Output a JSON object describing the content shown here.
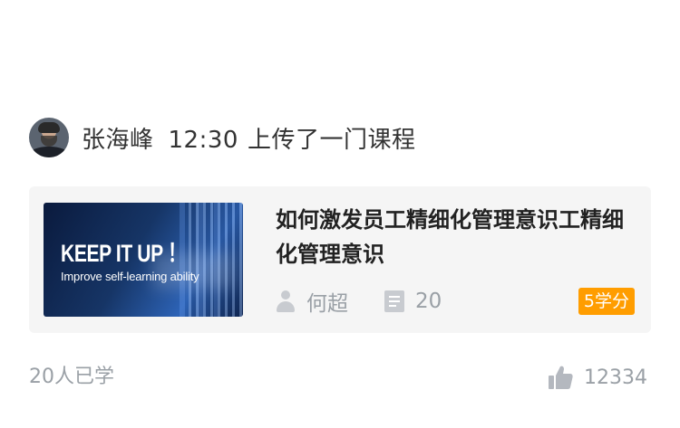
{
  "post": {
    "author": "张海峰",
    "time": "12:30",
    "action": "上传了一门课程"
  },
  "course": {
    "thumbnail_title": "KEEP IT UP ！",
    "thumbnail_subtitle": "Improve self-learning ability",
    "title": "如何激发员工精细化管理意识工精细化管理意识",
    "instructor": "何超",
    "lesson_count": "20",
    "credits": "5学分"
  },
  "footer": {
    "learners": "20人已学",
    "likes": "12334"
  },
  "icons": {
    "instructor": "person-icon",
    "lessons": "document-icon",
    "likes": "thumbs-up-icon"
  },
  "colors": {
    "badge": "#ff9d00",
    "card_bg": "#f5f5f5",
    "muted_text": "#9aa0a6"
  }
}
